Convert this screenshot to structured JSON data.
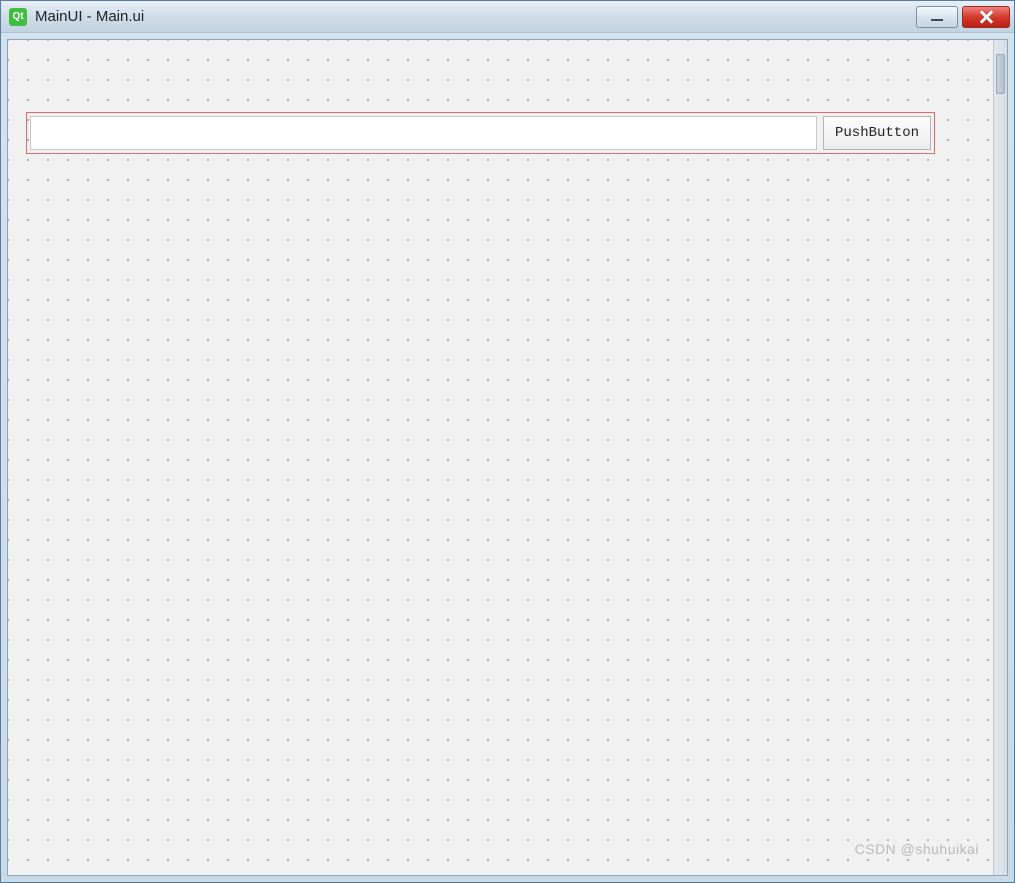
{
  "window": {
    "title": "MainUI - Main.ui",
    "app_icon_label": "Qt"
  },
  "controls": {
    "minimize_label": "Minimize",
    "close_label": "Close"
  },
  "form": {
    "input_value": "",
    "input_placeholder": "",
    "push_button_label": "PushButton"
  },
  "watermark": "CSDN @shuhuikai"
}
